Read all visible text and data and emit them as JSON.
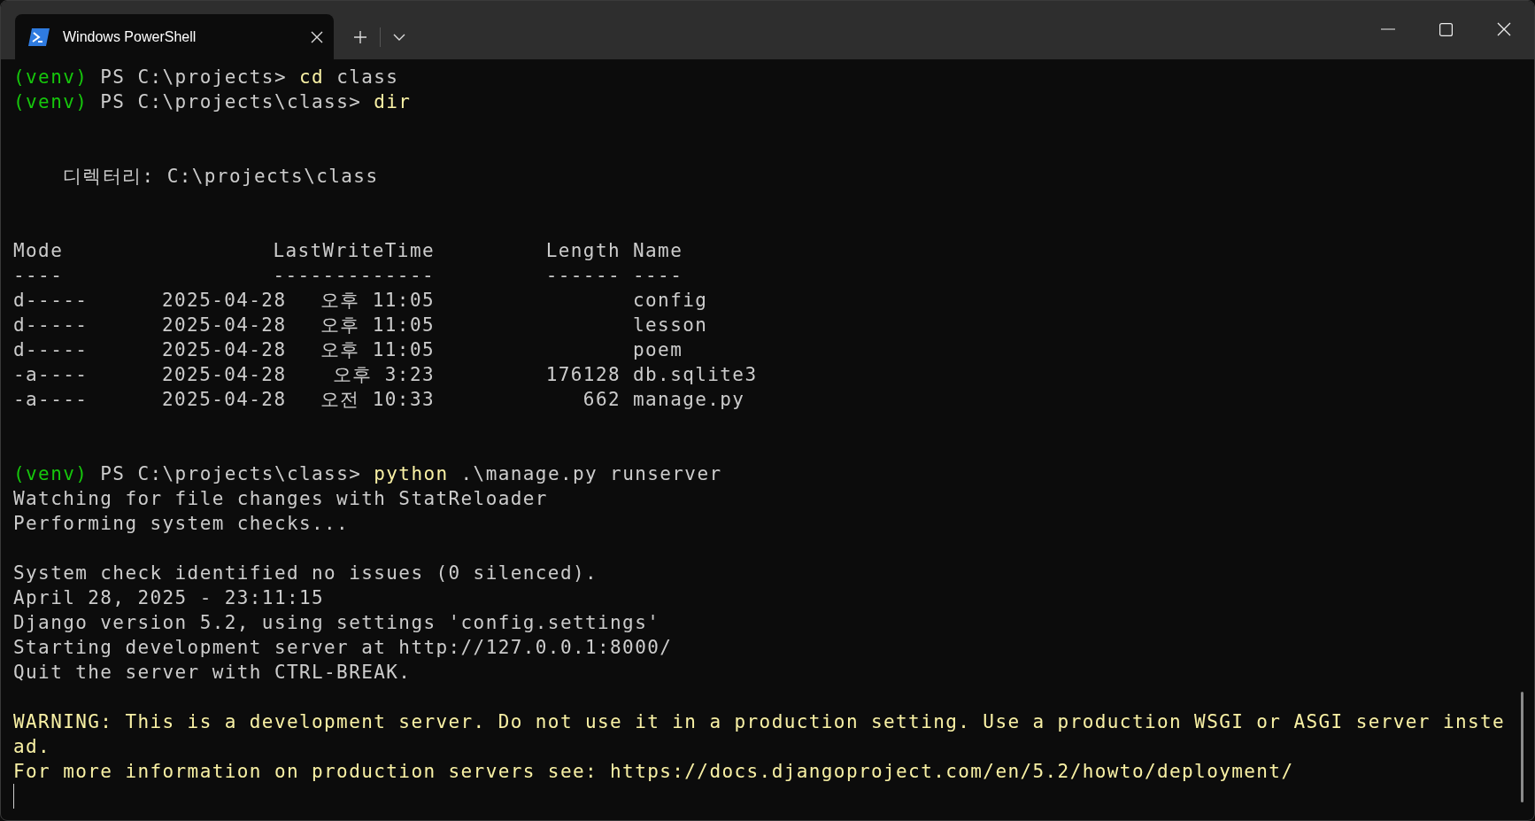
{
  "window": {
    "tab": {
      "title": "Windows PowerShell",
      "selected": true
    }
  },
  "lines": [
    {
      "kind": "prompt",
      "env": "(venv)",
      "path": "PS C:\\projects>",
      "command": "cd",
      "args": "class"
    },
    {
      "kind": "prompt",
      "env": "(venv)",
      "path": "PS C:\\projects\\class>",
      "command": "dir"
    },
    {
      "kind": "blank"
    },
    {
      "kind": "blank"
    },
    {
      "kind": "directory",
      "text": "디렉터리: C:\\projects\\class"
    },
    {
      "kind": "blank"
    },
    {
      "kind": "blank"
    },
    {
      "kind": "table",
      "columns": [
        {
          "label": "Mode",
          "rule": "----"
        },
        {
          "label": "LastWriteTime",
          "rule": "-------------"
        },
        {
          "label": "Length",
          "rule": "------"
        },
        {
          "label": "Name",
          "rule": "----"
        }
      ],
      "rows": [
        {
          "mode": "d-----",
          "date": "2025-04-28",
          "time": "오후 11:05",
          "name": "config"
        },
        {
          "mode": "d-----",
          "date": "2025-04-28",
          "time": "오후 11:05",
          "name": "lesson"
        },
        {
          "mode": "d-----",
          "date": "2025-04-28",
          "time": "오후 11:05",
          "name": "poem"
        },
        {
          "mode": "-a----",
          "date": "2025-04-28",
          "time": "오후 3:23",
          "length": "176128",
          "name": "db.sqlite3"
        },
        {
          "mode": "-a----",
          "date": "2025-04-28",
          "time": "오전 10:33",
          "length": "662",
          "name": "manage.py"
        }
      ]
    },
    {
      "kind": "blank"
    },
    {
      "kind": "blank"
    },
    {
      "kind": "prompt",
      "env": "(venv)",
      "path": "PS C:\\projects\\class>",
      "command": "python",
      "args": ".\\manage.py runserver"
    },
    {
      "kind": "output",
      "text": "Watching for file changes with StatReloader"
    },
    {
      "kind": "output",
      "text": "Performing system checks..."
    },
    {
      "kind": "blank"
    },
    {
      "kind": "output",
      "text": "System check identified no issues (0 silenced)."
    },
    {
      "kind": "output",
      "text": "April 28, 2025 - 23:11:15"
    },
    {
      "kind": "output",
      "text": "Django version 5.2, using settings 'config.settings'"
    },
    {
      "kind": "output",
      "text": "Starting development server at http://127.0.0.1:8000/"
    },
    {
      "kind": "output",
      "text": "Quit the server with CTRL-BREAK."
    },
    {
      "kind": "blank"
    },
    {
      "kind": "warning",
      "text": "WARNING: This is a development server. Do not use it in a production setting. Use a production WSGI or ASGI server inste"
    },
    {
      "kind": "warning",
      "text": "ad."
    },
    {
      "kind": "warning",
      "text": "For more information on production servers see: https://docs.djangoproject.com/en/5.2/howto/deployment/"
    },
    {
      "kind": "cursor"
    }
  ]
}
